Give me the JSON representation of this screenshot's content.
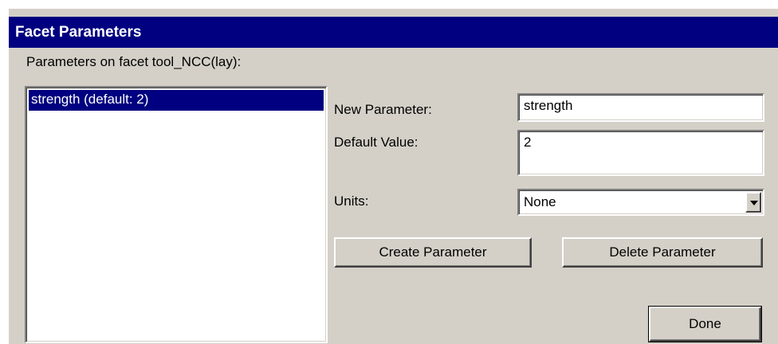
{
  "window": {
    "title": "Facet Parameters"
  },
  "header_label": "Parameters on facet tool_NCC(lay):",
  "parameter_list": {
    "items": [
      {
        "label": "strength (default: 2)",
        "selected": true
      }
    ]
  },
  "form": {
    "new_parameter": {
      "label": "New Parameter:",
      "value": "strength"
    },
    "default_value": {
      "label": "Default Value:",
      "value": "2"
    },
    "units": {
      "label": "Units:",
      "selected": "None"
    }
  },
  "buttons": {
    "create": "Create Parameter",
    "delete": "Delete Parameter",
    "done": "Done"
  },
  "icons": {
    "units_dropdown": "chevron-down-icon"
  },
  "colors": {
    "titlebar": "#000080",
    "dialog_bg": "#d4d0c8",
    "selection": "#000080"
  }
}
